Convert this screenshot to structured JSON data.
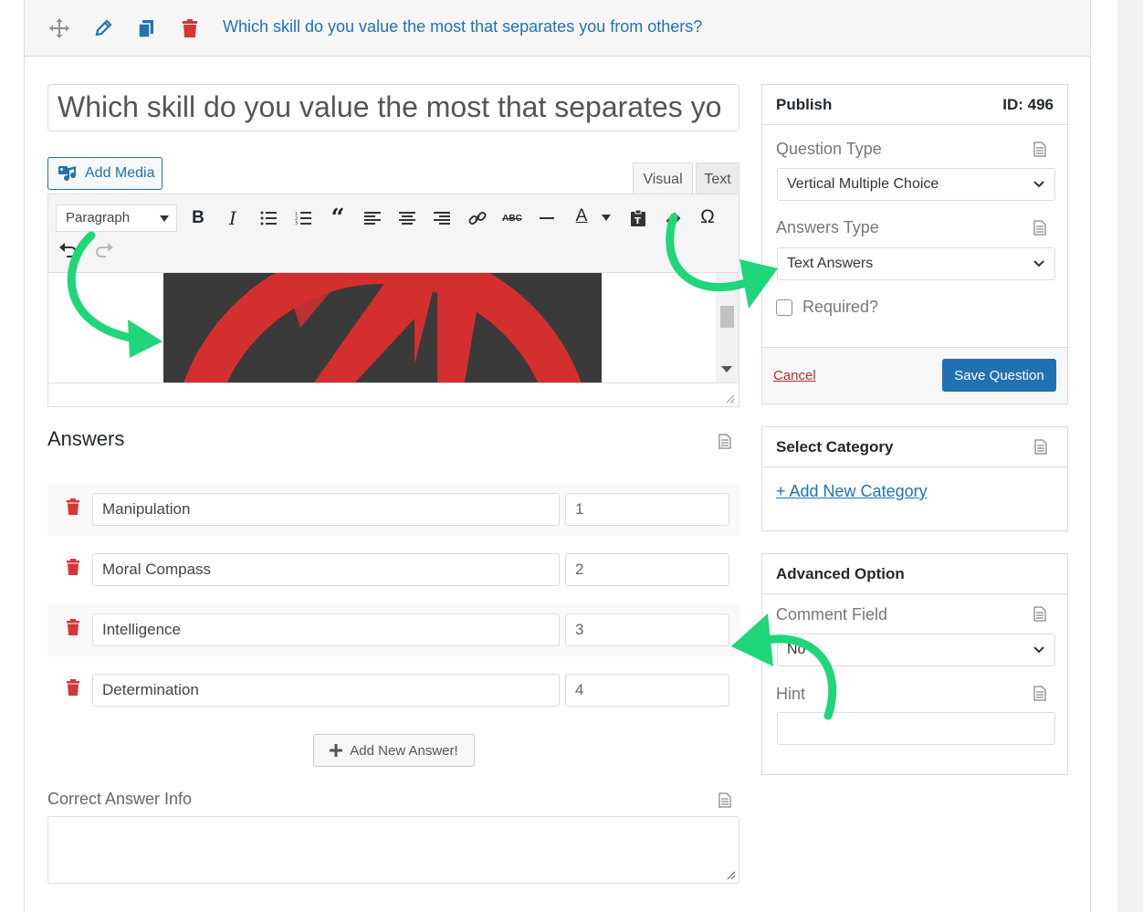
{
  "header": {
    "question_title": "Which skill do you value the most that separates you from others?",
    "icons": [
      "move-icon",
      "pencil-icon",
      "copy-icon",
      "trash-icon"
    ]
  },
  "editor": {
    "title_value": "Which skill do you value the most that separates yo",
    "add_media_label": "Add Media",
    "tabs": {
      "visual": "Visual",
      "text": "Text"
    },
    "format_select": "Paragraph"
  },
  "answers": {
    "heading": "Answers",
    "items": [
      {
        "text": "Manipulation",
        "value": "1"
      },
      {
        "text": "Moral Compass",
        "value": "2"
      },
      {
        "text": "Intelligence",
        "value": "3"
      },
      {
        "text": "Determination",
        "value": "4"
      }
    ],
    "add_label": "Add New Answer!"
  },
  "correct_answer": {
    "label": "Correct Answer Info"
  },
  "publish": {
    "title": "Publish",
    "id_label": "ID: 496",
    "question_type_label": "Question Type",
    "question_type_value": "Vertical Multiple Choice",
    "answers_type_label": "Answers Type",
    "answers_type_value": "Text Answers",
    "required_label": "Required?",
    "cancel_label": "Cancel",
    "save_label": "Save Question"
  },
  "category": {
    "title": "Select Category",
    "add_label": "+ Add New Category"
  },
  "advanced": {
    "title": "Advanced Option",
    "comment_label": "Comment Field",
    "comment_value": "No",
    "hint_label": "Hint"
  },
  "colors": {
    "accent": "#2271b1",
    "danger": "#d63638",
    "arrow": "#1fd67a"
  }
}
